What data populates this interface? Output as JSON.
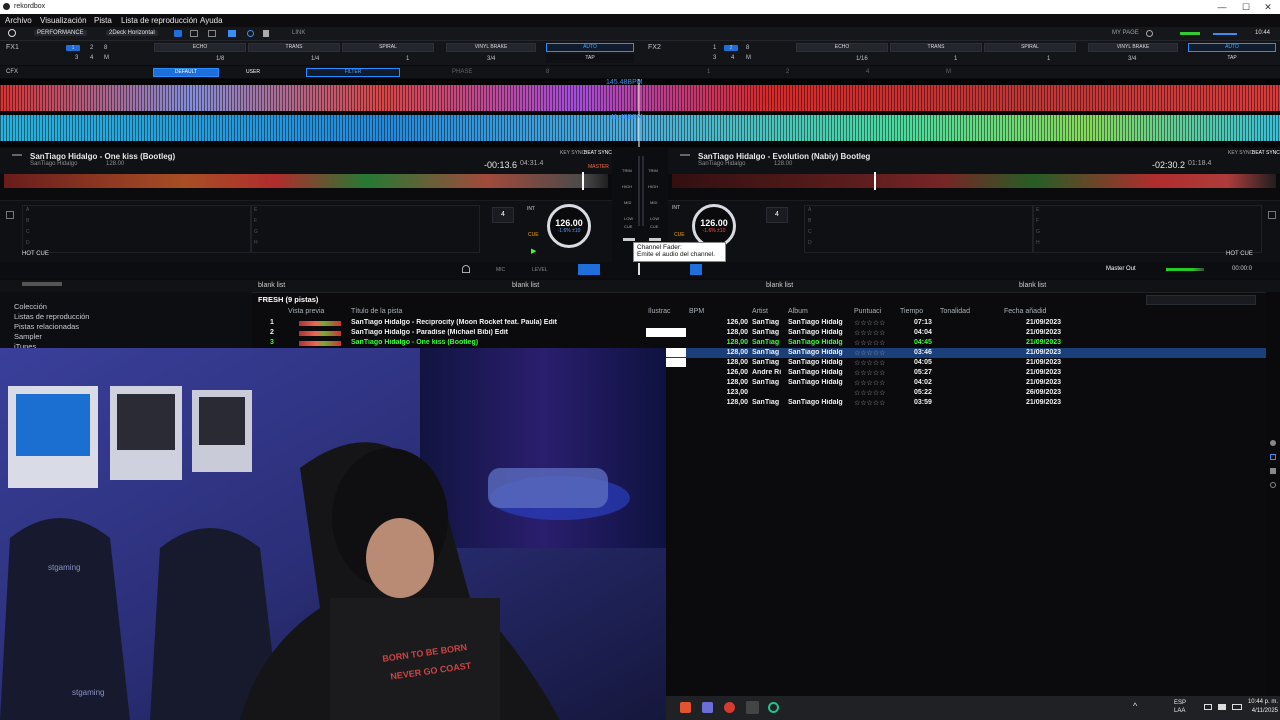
{
  "window": {
    "title": "rekordbox",
    "controls": [
      "—",
      "☐",
      "✕"
    ]
  },
  "menu": [
    "Archivo",
    "Visualización",
    "Pista",
    "Lista de reproducción",
    "Ayuda"
  ],
  "toolbar": {
    "mode": "PERFORMANCE",
    "layout": "2Deck Horizontal",
    "link": "LINK",
    "my_page": "MY PAGE",
    "clock": "10:44"
  },
  "fx1": {
    "label": "FX1",
    "beat_top": [
      "1",
      "2",
      "8"
    ],
    "beat_bottom": [
      "3",
      "4",
      "M"
    ],
    "effects": [
      "ECHO",
      "TRANS",
      "SPIRAL",
      "VINYL BRAKE"
    ],
    "values": [
      "1/8",
      "1/4",
      "1",
      "3/4"
    ],
    "auto": "AUTO",
    "tap": "TAP"
  },
  "fx2": {
    "label": "FX2",
    "beat_top": [
      "1",
      "2",
      "8"
    ],
    "beat_bottom": [
      "3",
      "4",
      "M"
    ],
    "effects": [
      "ECHO",
      "TRANS",
      "SPIRAL",
      "VINYL BRAKE"
    ],
    "values": [
      "1/16",
      "1",
      "1",
      "3/4"
    ],
    "auto": "AUTO",
    "tap": "TAP"
  },
  "cfx": {
    "label": "CFX",
    "default": "DEFAULT",
    "user": "USER",
    "filter": "FILTER",
    "phase": "PHASE",
    "markers": [
      "8",
      "1",
      "2",
      "4",
      "M"
    ]
  },
  "waveform": {
    "bpm_top": "145.48BPM",
    "bpm_bottom": "41.48BPM"
  },
  "deck1": {
    "title": "SanTiago Hidalgo - One kiss (Bootleg)",
    "artist": "SanTiago Hidalgo",
    "bpm_small": "128.00",
    "remaining": "-00:13.6",
    "total": "04:31.4",
    "key_sync": "KEY SYNC",
    "beat_sync": "BEAT SYNC",
    "master": "MASTER",
    "int": "INT",
    "loop": "4",
    "jog_bpm": "126.00",
    "jog_pct": "-1.6%  ±10",
    "hot_cue": "HOT CUE",
    "cue": "CUE",
    "pads": [
      "A",
      "B",
      "C",
      "D",
      "E",
      "F",
      "G",
      "H"
    ]
  },
  "deck2": {
    "title": "SanTiago Hidalgo - Evolution (Nabiy) Bootleg",
    "artist": "SanTiago Hidalgo",
    "bpm_small": "128.00",
    "remaining": "-02:30.2",
    "total": "01:18.4",
    "key_sync": "KEY SYNC",
    "beat_sync": "BEAT SYNC",
    "int": "INT",
    "loop": "4",
    "jog_bpm": "126.00",
    "jog_pct": "-1.6%  ±10",
    "hot_cue": "HOT CUE",
    "cue": "CUE",
    "pads": [
      "A",
      "B",
      "C",
      "D",
      "E",
      "F",
      "G",
      "H"
    ]
  },
  "mixer": {
    "trim": "TRIM",
    "high": "HIGH",
    "mid": "MID",
    "low": "LOW",
    "cue": "CUE"
  },
  "tooltip": {
    "title": "Channel Fader:",
    "text": "Emite el audio del channel."
  },
  "browser_bar": {
    "mic": "MIC",
    "level": "LEVEL",
    "master_out": "Master Out",
    "time": "00:00:0",
    "panels": [
      "blank list",
      "blank list",
      "blank list",
      "blank list"
    ]
  },
  "tree": [
    "Colección",
    "Listas de reproducción",
    "Pistas relacionadas",
    "Sampler",
    "iTunes"
  ],
  "playlist": {
    "title": "FRESH (9 pistas)",
    "headers": [
      "Vista previa",
      "Título de la pista",
      "Ilustrac",
      "BPM",
      "Artist",
      "Album",
      "Puntuaci",
      "Tiempo",
      "Tonalidad",
      "Fecha añadid"
    ],
    "rows": [
      {
        "num": "1",
        "title": "SanTiago Hidalgo - Reciprocity (Moon Rocket feat. Paula) Edit",
        "bpm": "126,00",
        "artist": "SanTiag",
        "album": "SanTiago Hidalg",
        "rating": "☆☆☆☆☆",
        "time": "07:13",
        "date": "21/09/2023"
      },
      {
        "num": "2",
        "title": "SanTiago Hidalgo - Paradise (Michael Bibi) Edit",
        "bpm": "128,00",
        "artist": "SanTiag",
        "album": "SanTiago Hidalg",
        "rating": "☆☆☆☆☆",
        "time": "04:04",
        "date": "21/09/2023"
      },
      {
        "num": "3",
        "title": "SanTiago Hidalgo - One kiss (Bootleg)",
        "bpm": "128,00",
        "artist": "SanTiag",
        "album": "SanTiago Hidalg",
        "rating": "☆☆☆☆☆",
        "time": "04:45",
        "date": "21/09/2023"
      },
      {
        "num": "",
        "title": "",
        "bpm": "128,00",
        "artist": "SanTiag",
        "album": "SanTiago Hidalg",
        "rating": "☆☆☆☆☆",
        "time": "03:46",
        "date": "21/09/2023"
      },
      {
        "num": "",
        "title": "",
        "bpm": "128,00",
        "artist": "SanTiag",
        "album": "SanTiago Hidalg",
        "rating": "☆☆☆☆☆",
        "time": "04:05",
        "date": "21/09/2023"
      },
      {
        "num": "",
        "title": "",
        "bpm": "126,00",
        "artist": "Andre Ri",
        "album": "SanTiago Hidalg",
        "rating": "☆☆☆☆☆",
        "time": "05:27",
        "date": "21/09/2023"
      },
      {
        "num": "",
        "title": "",
        "bpm": "128,00",
        "artist": "SanTiag",
        "album": "SanTiago Hidalg",
        "rating": "☆☆☆☆☆",
        "time": "04:02",
        "date": "21/09/2023"
      },
      {
        "num": "",
        "title": "",
        "bpm": "123,00",
        "artist": "",
        "album": "",
        "rating": "☆☆☆☆☆",
        "time": "05:22",
        "date": "26/09/2023"
      },
      {
        "num": "",
        "title": "",
        "bpm": "128,00",
        "artist": "SanTiag",
        "album": "SanTiago Hidalg",
        "rating": "☆☆☆☆☆",
        "time": "03:59",
        "date": "21/09/2023"
      }
    ]
  },
  "webcam": {
    "chair_brand": "stgaming",
    "shirt_text_1": "BORN TO BE BORN",
    "shirt_text_2": "NEVER GO COAST"
  },
  "taskbar": {
    "lang": "ESP",
    "lang2": "LAA",
    "time": "10:44 p. m.",
    "date": "4/11/2025"
  },
  "colors": {
    "accent": "#1e6fd9",
    "playing": "#3cff3c",
    "selected_row": "#1a3f7a"
  }
}
